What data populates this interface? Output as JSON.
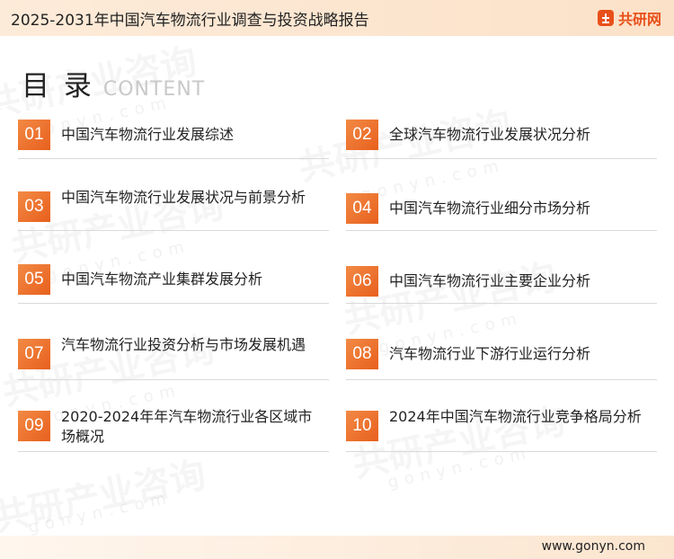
{
  "header": {
    "title": "2025-2031年中国汽车物流行业调查与投资战略报告",
    "brand_name": "共研网",
    "brand_color": "#e8501a",
    "background": "#fbe6d2"
  },
  "heading": {
    "main": "目 录",
    "sub": "CONTENT"
  },
  "accent_color": "#ef7531",
  "watermark": {
    "text": "共研产业咨询",
    "url": "gonyn.com"
  },
  "toc": [
    {
      "number": "01",
      "title": "中国汽车物流行业发展综述"
    },
    {
      "number": "02",
      "title": "全球汽车物流行业发展状况分析"
    },
    {
      "number": "03",
      "title": "中国汽车物流行业发展状况与前景分析"
    },
    {
      "number": "04",
      "title": "中国汽车物流行业细分市场分析"
    },
    {
      "number": "05",
      "title": "中国汽车物流产业集群发展分析"
    },
    {
      "number": "06",
      "title": "中国汽车物流行业主要企业分析"
    },
    {
      "number": "07",
      "title": "汽车物流行业投资分析与市场发展机遇"
    },
    {
      "number": "08",
      "title": "汽车物流行业下游行业运行分析"
    },
    {
      "number": "09",
      "title": "2020-2024年年汽车物流行业各区域市场概况"
    },
    {
      "number": "10",
      "title": "2024年中国汽车物流行业竞争格局分析"
    }
  ],
  "footer": {
    "url": "www.gonyn.com"
  }
}
